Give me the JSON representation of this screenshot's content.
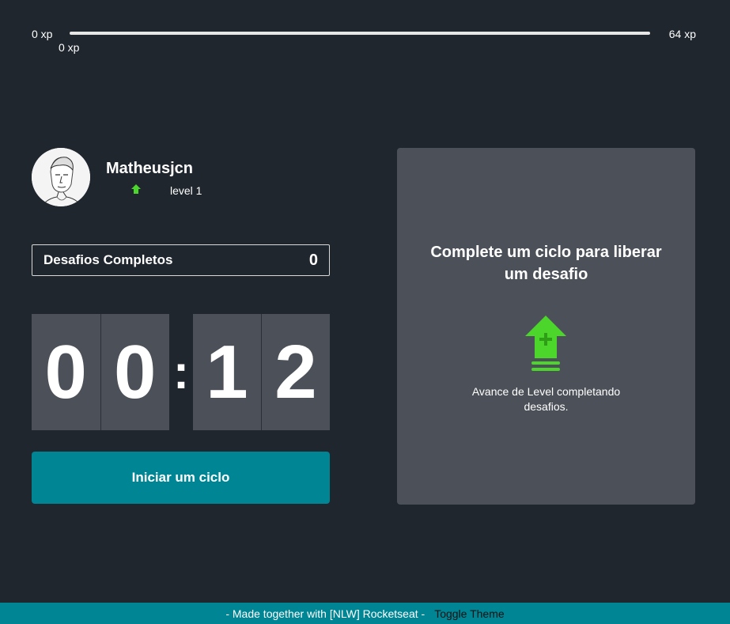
{
  "xp": {
    "min_label": "0 xp",
    "max_label": "64 xp",
    "current_label": "0 xp",
    "progress_fraction": 0
  },
  "profile": {
    "username": "Matheusjcn",
    "level_label": "level 1",
    "level_icon": "level-up-arrow-icon"
  },
  "challenges_completed": {
    "label": "Desafios Completos",
    "count": "0"
  },
  "countdown": {
    "minute_left": "0",
    "minute_right": "0",
    "separator": ":",
    "second_left": "1",
    "second_right": "2"
  },
  "start_button": {
    "label": "Iniciar um ciclo"
  },
  "challenge_box": {
    "title": "Complete um ciclo para liberar um desafio",
    "icon": "level-up-icon",
    "description": "Avance de Level completando desafios."
  },
  "footer": {
    "text": "- Made together with [NLW] Rocketseat -",
    "toggle_label": "Toggle Theme"
  },
  "colors": {
    "background": "#1f262e",
    "card": "#4c5058",
    "accent": "#008594",
    "green": "#4cd62b"
  }
}
